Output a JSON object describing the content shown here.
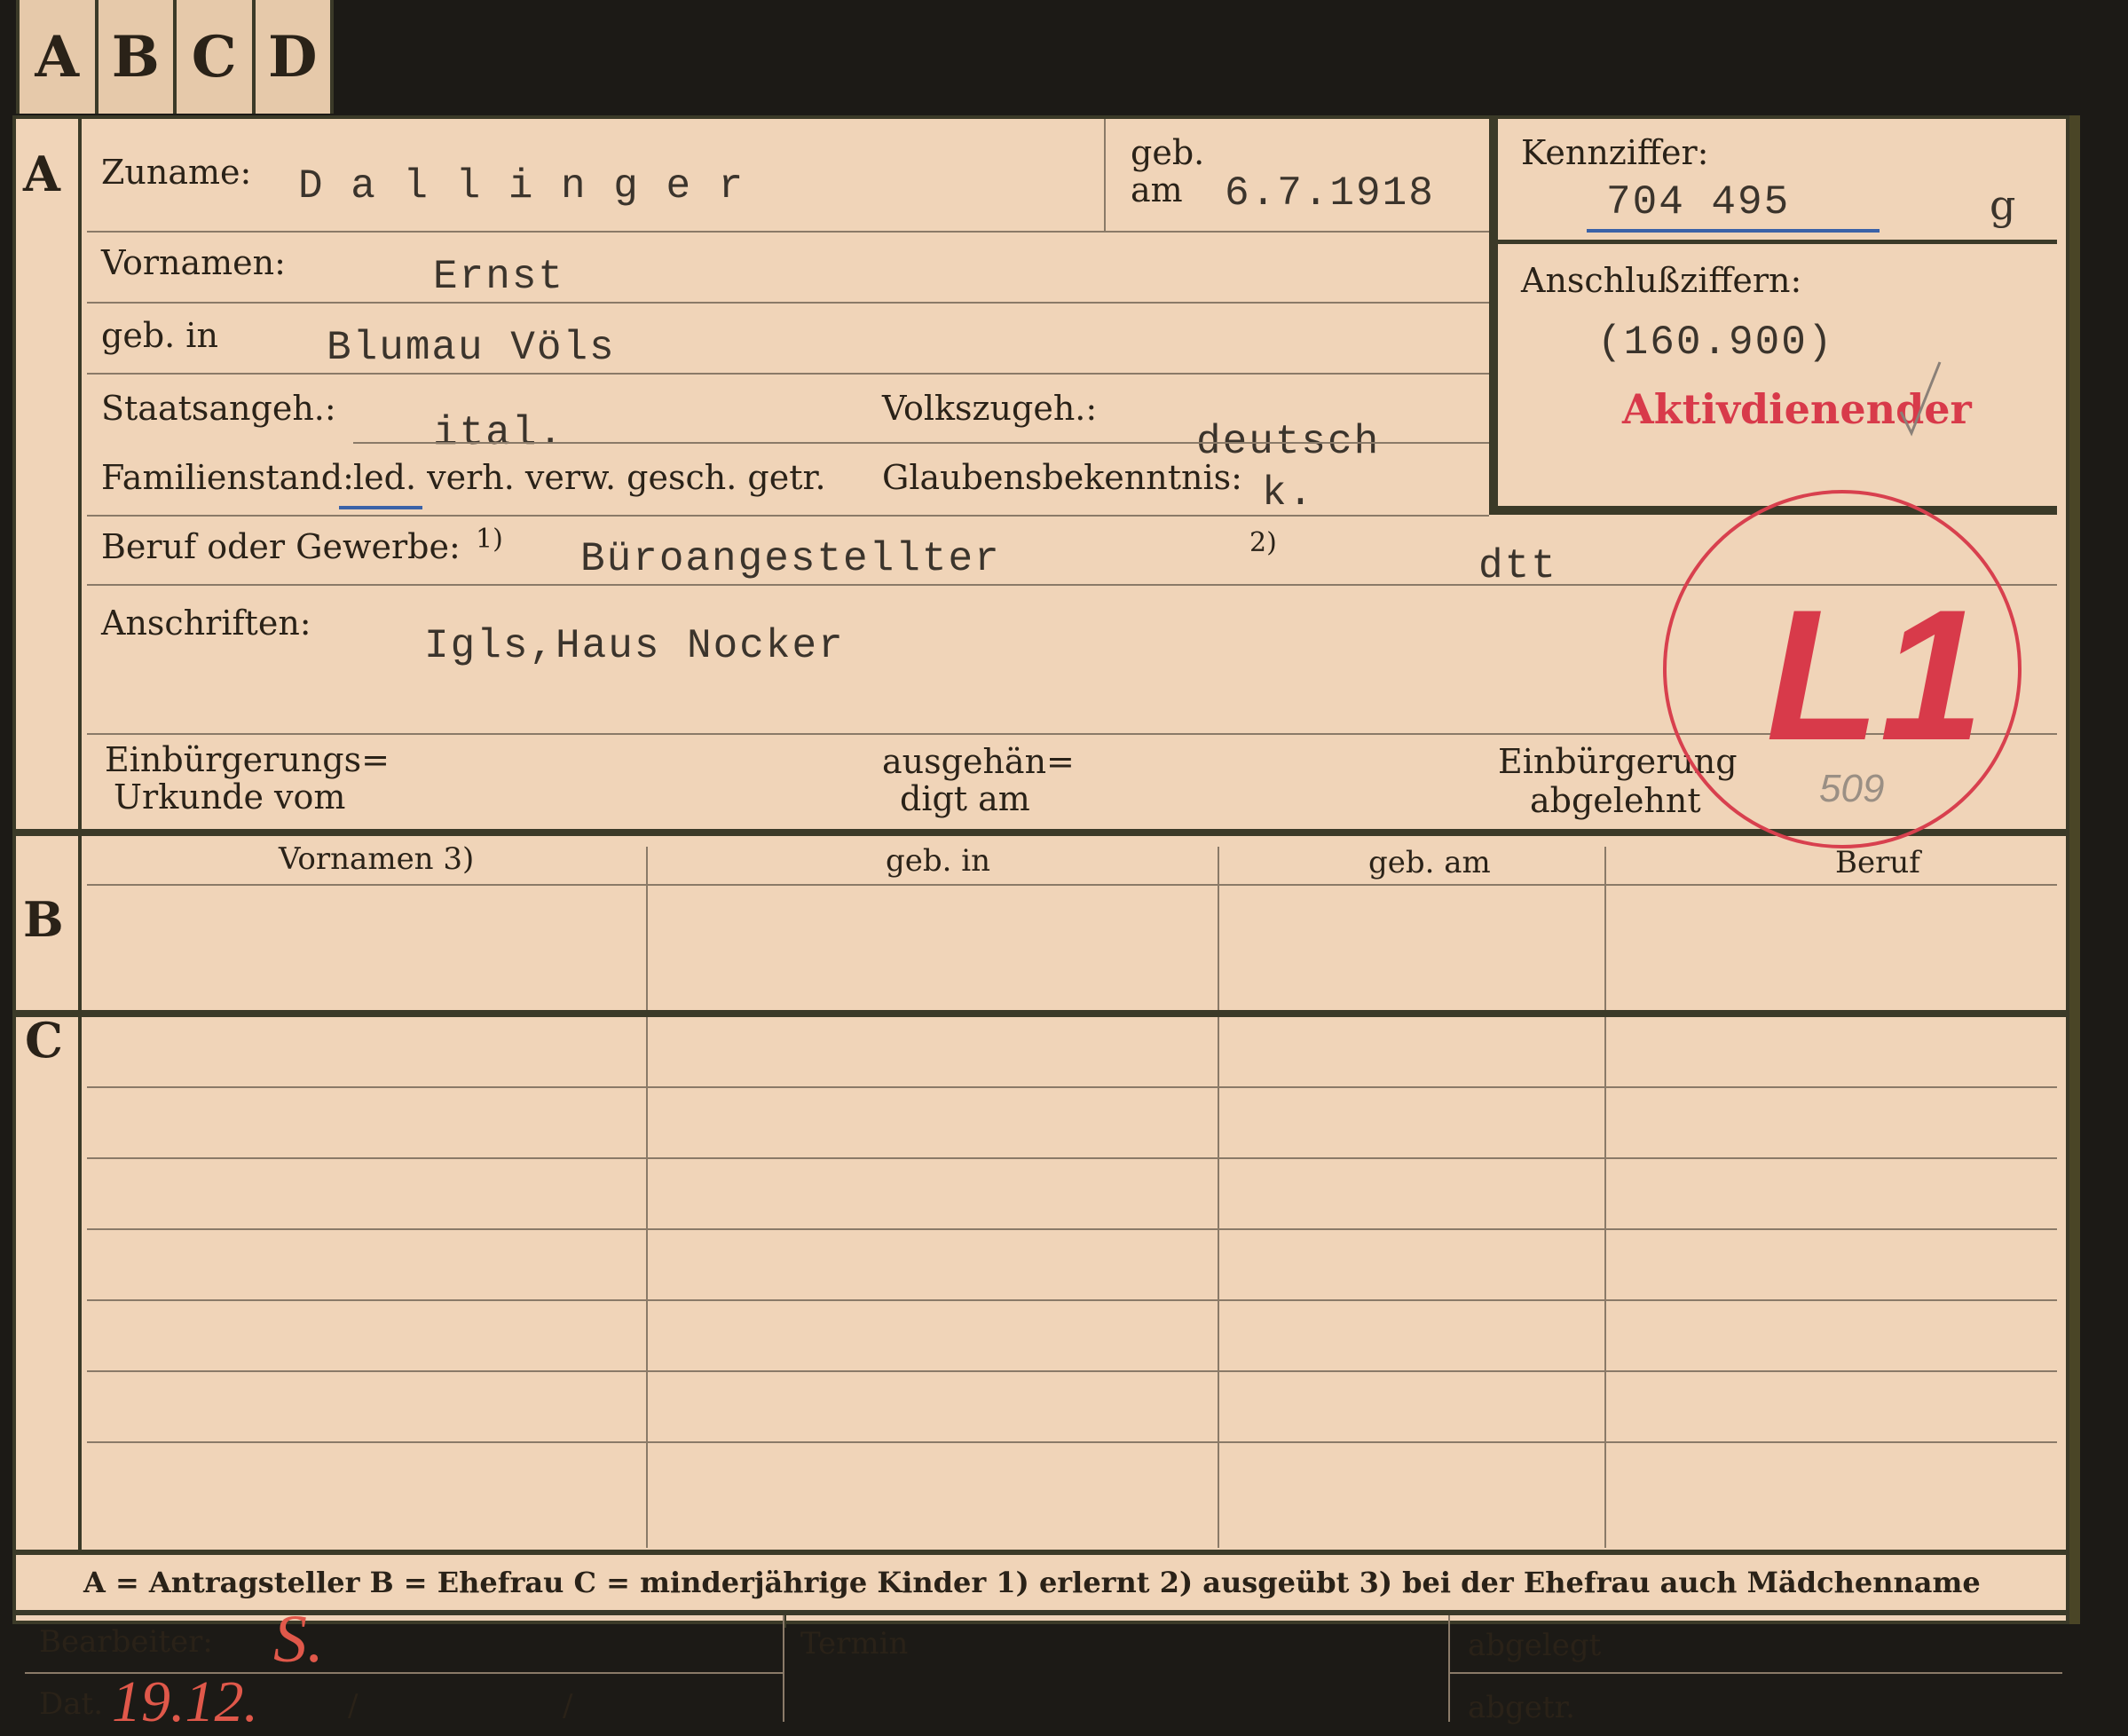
{
  "tabs": [
    "A",
    "B",
    "C",
    "D"
  ],
  "sections": {
    "a": "A",
    "b": "B",
    "c": "C"
  },
  "surname": {
    "label": "Zuname:",
    "value": "D a l l i n g e r"
  },
  "born": {
    "label_top": "geb.",
    "label_bottom": "am",
    "value": "6.7.1918"
  },
  "id_number": {
    "label": "Kennziffer:",
    "value": "704 495",
    "suffix": "g"
  },
  "connection": {
    "label": "Anschlußziffern:",
    "value": "(160.900)",
    "stamp": "Aktivdienender"
  },
  "given_names": {
    "label": "Vornamen:",
    "value": "Ernst"
  },
  "birthplace": {
    "label": "geb. in",
    "value": "Blumau Völs"
  },
  "citizenship": {
    "label": "Staatsangeh.:",
    "value": "ital."
  },
  "ethnicity": {
    "label": "Volkszugeh.:",
    "value": "deutsch"
  },
  "marital": {
    "label": "Familienstand:",
    "options": "led. verh. verw. gesch. getr."
  },
  "religion": {
    "label": "Glaubensbekenntnis:",
    "value": "k."
  },
  "profession": {
    "label": "Beruf oder Gewerbe:",
    "note1": "1)",
    "value": "Büroangestellter",
    "note2": "2)",
    "value2": "dtt"
  },
  "address": {
    "label": "Anschriften:",
    "value": "Igls,Haus Nocker"
  },
  "naturalization": {
    "doc_line1": "Einbürgerungs=",
    "doc_line2": "Urkunde vom",
    "handed_line1": "ausgehän=",
    "handed_line2": "digt am",
    "rejected_line1": "Einbürgerung",
    "rejected_line2": "abgelehnt"
  },
  "stamp_circle": {
    "text": "L1",
    "pencil": "509"
  },
  "table": {
    "headers": [
      "Vornamen 3)",
      "geb. in",
      "geb. am",
      "Beruf"
    ]
  },
  "footer": {
    "legend": "A = Antragsteller    B = Ehefrau    C = minderjährige Kinder    1) erlernt    2) ausgeübt    3) bei der Ehefrau auch Mädchenname"
  },
  "bottom": {
    "clerk_label": "Bearbeiter:",
    "clerk_value": "S.",
    "date_label": "Dat.",
    "date_value": "19.12.",
    "date_sep": "/",
    "term_label": "Termin",
    "filed_label": "abgelegt",
    "filed2_label": "abgetr."
  },
  "colors": {
    "card": "#f0d4b8",
    "ink": "#2a2218",
    "stamp_red": "#d83a4a",
    "border": "#3b3a28"
  }
}
